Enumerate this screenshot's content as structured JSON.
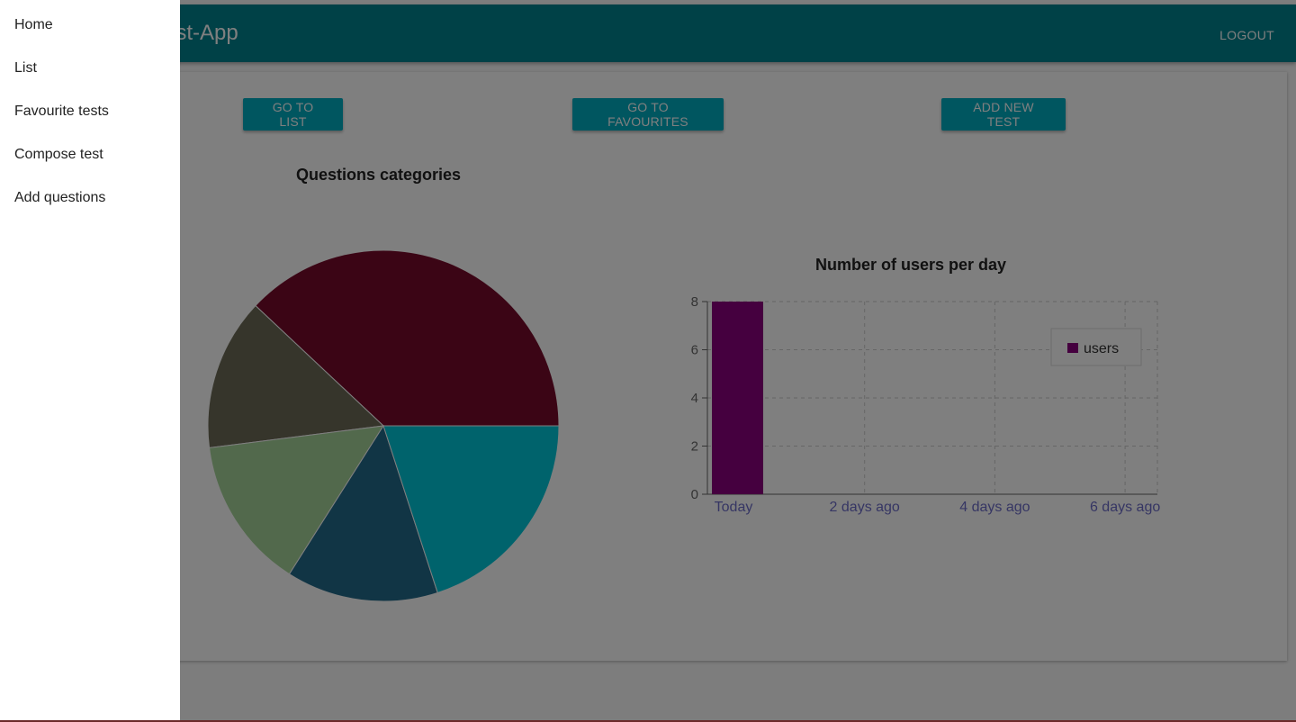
{
  "appbar": {
    "title": "Test-App",
    "logout_label": "LOGOUT",
    "color": "#00838f"
  },
  "actions": {
    "go_to_list": "GO TO LIST",
    "go_to_favourites": "GO TO FAVOURITES",
    "add_new_test": "ADD NEW TEST"
  },
  "drawer": {
    "items": [
      {
        "label": "Home"
      },
      {
        "label": "List"
      },
      {
        "label": "Favourite tests"
      },
      {
        "label": "Compose test"
      },
      {
        "label": "Add questions"
      }
    ]
  },
  "chart_data": [
    {
      "type": "pie",
      "title": "Questions categories",
      "values": [
        38,
        14,
        14,
        14,
        20
      ],
      "colors": [
        "#770b2a",
        "#6c6a57",
        "#a5d298",
        "#236a8a",
        "#00c7d9"
      ],
      "legend": false
    },
    {
      "type": "bar",
      "title": "Number of users per day",
      "categories": [
        "Today",
        "2 days ago",
        "4 days ago",
        "6 days ago"
      ],
      "series": [
        {
          "name": "users",
          "values": [
            8,
            0,
            0,
            0
          ],
          "color": "#8a007f"
        }
      ],
      "ylim": [
        0,
        8
      ],
      "yticks": [
        "0",
        "2",
        "4",
        "6",
        "8"
      ],
      "grid": true,
      "legend": "top-right"
    }
  ]
}
